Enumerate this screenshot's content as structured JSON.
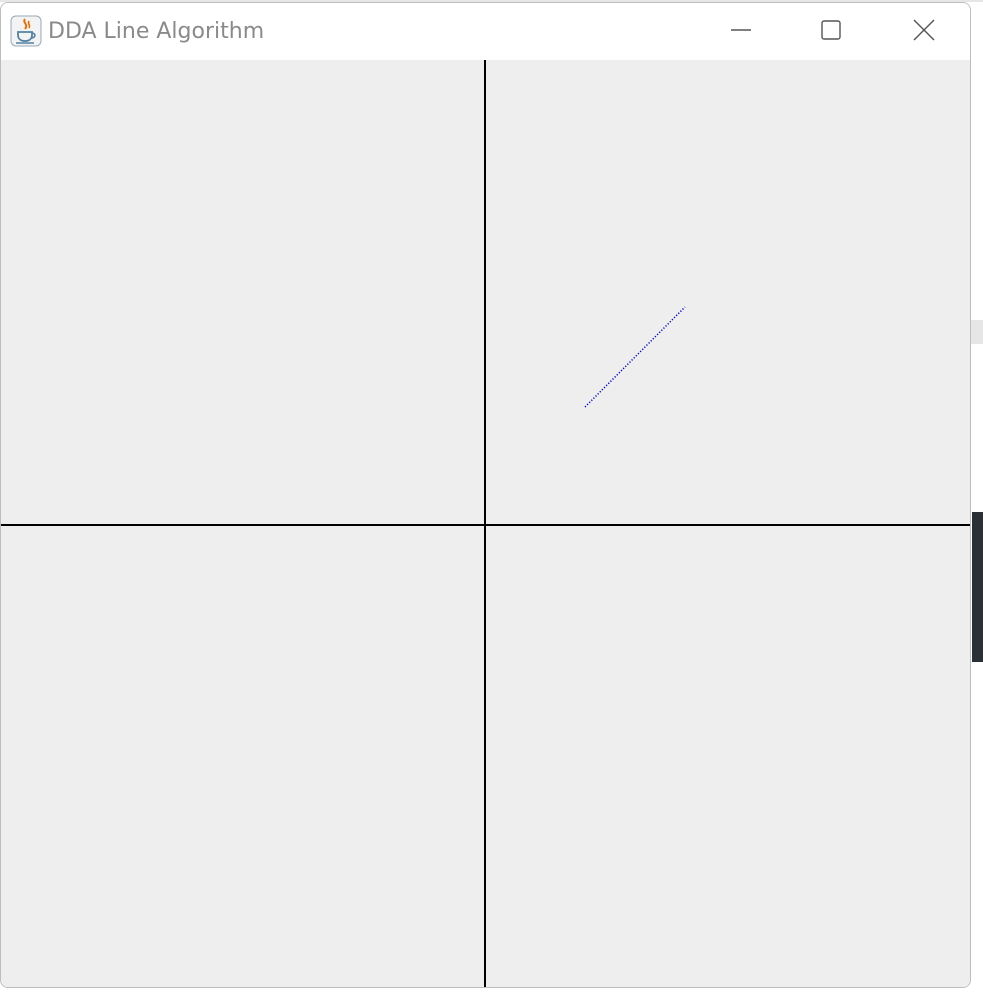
{
  "window": {
    "title": "DDA Line Algorithm"
  },
  "icons": {
    "app": "java-coffee-cup-icon",
    "minimize": "minimize-icon",
    "maximize": "maximize-icon",
    "close": "close-icon"
  },
  "colors": {
    "canvas_background": "#eeeeee",
    "axes": "#000000",
    "line": "#0000cc",
    "title_text": "#8a8a8a"
  },
  "drawing": {
    "axes": "x and y axes crossing at canvas center",
    "line_segment": {
      "start": [
        100,
        118
      ],
      "end": [
        200,
        218
      ],
      "style": "dotted"
    }
  }
}
